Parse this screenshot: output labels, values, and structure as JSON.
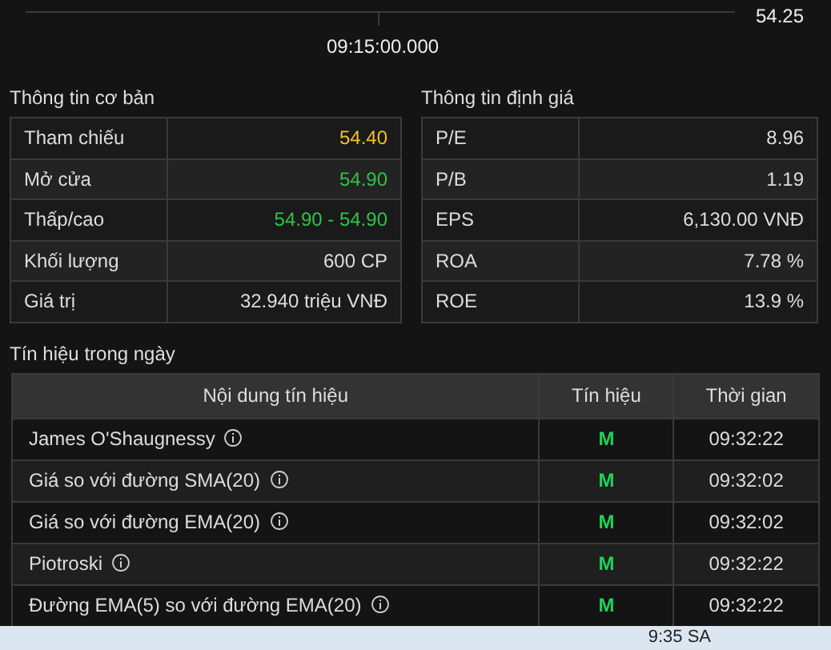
{
  "chart": {
    "price_label": "54.25",
    "time_label": "09:15:00.000"
  },
  "basic_info": {
    "title": "Thông tin cơ bản",
    "rows": [
      {
        "label": "Tham chiếu",
        "value": "54.40",
        "color": "#f0c020"
      },
      {
        "label": "Mở cửa",
        "value": "54.90",
        "color": "#2fc24a"
      },
      {
        "label": "Thấp/cao",
        "value": "54.90 - 54.90",
        "color": "#2fc24a"
      },
      {
        "label": "Khối lượng",
        "value": "600 CP",
        "color": "#dddddd"
      },
      {
        "label": "Giá trị",
        "value": "32.940 triệu VNĐ",
        "color": "#dddddd"
      }
    ]
  },
  "valuation": {
    "title": "Thông tin định giá",
    "rows": [
      {
        "label": "P/E",
        "value": "8.96"
      },
      {
        "label": "P/B",
        "value": "1.19"
      },
      {
        "label": "EPS",
        "value": "6,130.00 VNĐ"
      },
      {
        "label": "ROA",
        "value": "7.78 %"
      },
      {
        "label": "ROE",
        "value": "13.9 %"
      }
    ]
  },
  "signals": {
    "title": "Tín hiệu trong ngày",
    "columns": [
      "Nội dung tín hiệu",
      "Tín hiệu",
      "Thời gian"
    ],
    "rows": [
      {
        "content": "James O'Shaugnessy",
        "signal": "M",
        "time": "09:32:22"
      },
      {
        "content": "Giá so với đường SMA(20)",
        "signal": "M",
        "time": "09:32:02"
      },
      {
        "content": "Giá so với đường EMA(20)",
        "signal": "M",
        "time": "09:32:02"
      },
      {
        "content": "Piotroski",
        "signal": "M",
        "time": "09:32:22"
      },
      {
        "content": "Đường EMA(5) so với đường EMA(20)",
        "signal": "M",
        "time": "09:32:22"
      }
    ]
  },
  "taskbar": {
    "clock": "9:35 SA"
  }
}
